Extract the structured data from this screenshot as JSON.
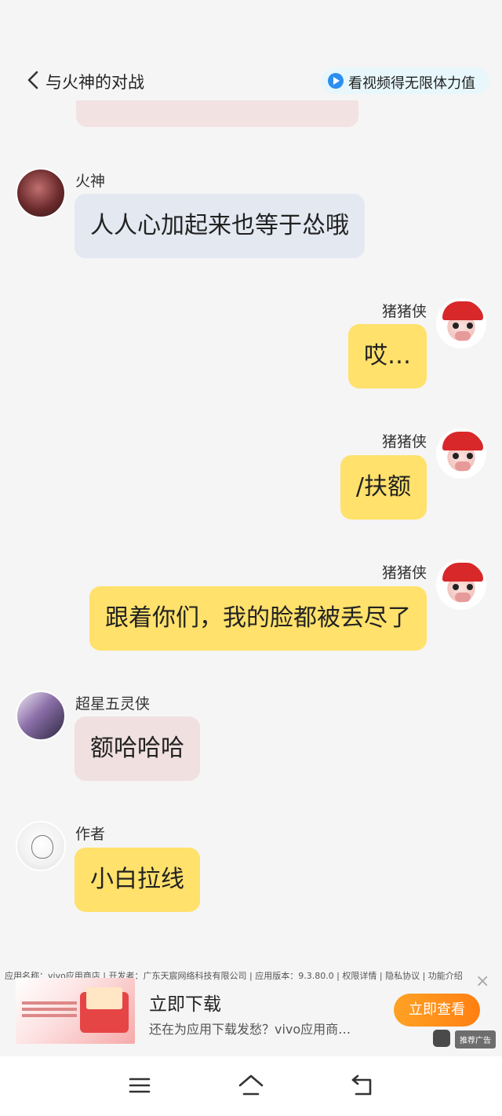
{
  "header": {
    "title": "与火神的对战",
    "video_button": "看视频得无限体力值"
  },
  "messages": [
    {
      "sender": "火神",
      "text": "人人心加起来也等于怂哦",
      "side": "left"
    },
    {
      "sender": "猪猪侠",
      "text": "哎…",
      "side": "right"
    },
    {
      "sender": "猪猪侠",
      "text": "/扶额",
      "side": "right"
    },
    {
      "sender": "猪猪侠",
      "text": "跟着你们，我的脸都被丢尽了",
      "side": "right"
    },
    {
      "sender": "超星五灵侠",
      "text": "额哈哈哈",
      "side": "left"
    },
    {
      "sender": "作者",
      "text": "小白拉线",
      "side": "left"
    }
  ],
  "ad": {
    "info": "应用名称：vivo应用商店 | 开发者：广东天宸网络科技有限公司 | 应用版本：9.3.80.0 | 权限详情 | 隐私协议 | 功能介绍",
    "title": "立即下载",
    "description": "还在为应用下载发愁？vivo应用商…",
    "button": "立即查看",
    "badge": "推荐广告",
    "close": "×"
  },
  "colors": {
    "bubble_blue": "#e3e8f1",
    "bubble_yellow": "#ffe16b",
    "bubble_pink": "#f0e0e0",
    "accent_orange": "#ff8f1a",
    "video_blue": "#2d8ef0"
  },
  "navbar": {
    "icons": [
      "menu-icon",
      "home-icon",
      "back-icon"
    ]
  }
}
